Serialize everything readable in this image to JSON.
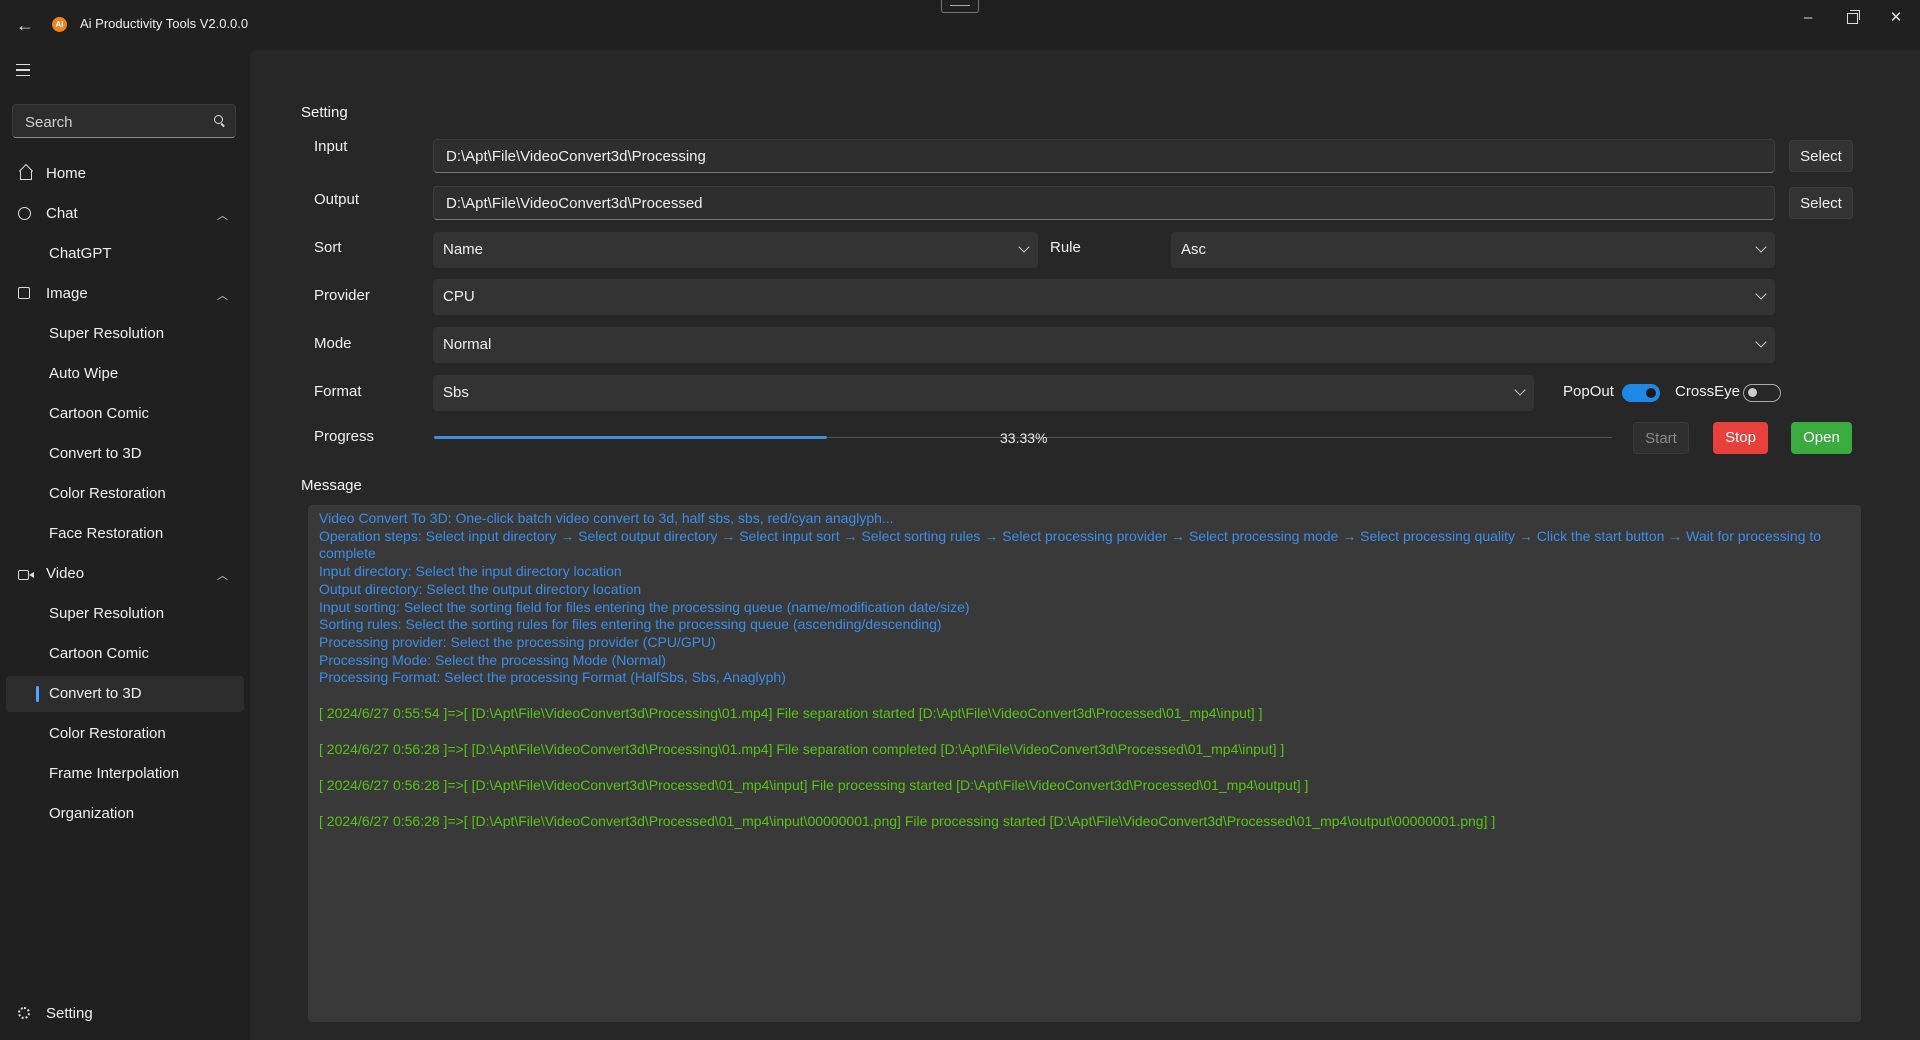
{
  "app": {
    "title": "Ai Productivity Tools V2.0.0.0",
    "logo_text": "AI",
    "back_icon": "arrow-left-icon",
    "colors": {
      "accent": "#4aa8ff",
      "stop": "#e8413c",
      "open": "#3bab3f",
      "info_text": "#3b8de8",
      "log_text": "#57c414"
    }
  },
  "window": {
    "minimize": "–",
    "close": "✕"
  },
  "sidebar": {
    "search_placeholder": "Search",
    "items": [
      {
        "label": "Home"
      },
      {
        "label": "Chat"
      },
      {
        "label": "ChatGPT"
      },
      {
        "label": "Image"
      },
      {
        "label": "Super Resolution"
      },
      {
        "label": "Auto Wipe"
      },
      {
        "label": "Cartoon Comic"
      },
      {
        "label": "Convert to 3D"
      },
      {
        "label": "Color Restoration"
      },
      {
        "label": "Face Restoration"
      },
      {
        "label": "Video"
      },
      {
        "label": "Super Resolution"
      },
      {
        "label": "Cartoon Comic"
      },
      {
        "label": "Convert to 3D"
      },
      {
        "label": "Color Restoration"
      },
      {
        "label": "Frame Interpolation"
      },
      {
        "label": "Organization"
      }
    ],
    "footer": {
      "label": "Setting"
    }
  },
  "setting": {
    "title": "Setting",
    "input": {
      "label": "Input",
      "value": "D:\\Apt\\File\\VideoConvert3d\\Processing",
      "button": "Select"
    },
    "output": {
      "label": "Output",
      "value": "D:\\Apt\\File\\VideoConvert3d\\Processed",
      "button": "Select"
    },
    "sort": {
      "label": "Sort",
      "value": "Name"
    },
    "rule": {
      "label": "Rule",
      "value": "Asc"
    },
    "provider": {
      "label": "Provider",
      "value": "CPU"
    },
    "mode": {
      "label": "Mode",
      "value": "Normal"
    },
    "format": {
      "label": "Format",
      "value": "Sbs"
    },
    "popout": {
      "label": "PopOut",
      "on": true
    },
    "crosseye": {
      "label": "CrossEye",
      "on": false
    },
    "progress": {
      "label": "Progress",
      "text": "33.33%",
      "fraction": 0.3333
    },
    "buttons": {
      "start": "Start",
      "stop": "Stop",
      "open": "Open"
    }
  },
  "message": {
    "title": "Message",
    "intro": [
      "Video Convert To 3D: One-click batch video convert to 3d, half sbs, sbs, red/cyan anaglyph...",
      "Operation steps: Select input directory → Select output directory → Select input sort → Select sorting rules → Select processing provider → Select processing mode → Select processing quality → Click the start button → Wait for processing to complete",
      "Input directory: Select the input directory location",
      "Output directory: Select the output directory location",
      "Input sorting: Select the sorting field for files entering the processing queue (name/modification date/size)",
      "Sorting rules: Select the sorting rules for files entering the processing queue (ascending/descending)",
      "Processing provider: Select the processing provider (CPU/GPU)",
      "Processing Mode: Select the processing Mode (Normal)",
      "Processing Format: Select the processing Format (HalfSbs, Sbs, Anaglyph)"
    ],
    "logs": [
      "[ 2024/6/27 0:55:54 ]=>[ [D:\\Apt\\File\\VideoConvert3d\\Processing\\01.mp4] File separation started [D:\\Apt\\File\\VideoConvert3d\\Processed\\01_mp4\\input] ]",
      "[ 2024/6/27 0:56:28 ]=>[ [D:\\Apt\\File\\VideoConvert3d\\Processing\\01.mp4] File separation completed [D:\\Apt\\File\\VideoConvert3d\\Processed\\01_mp4\\input] ]",
      "[ 2024/6/27 0:56:28 ]=>[ [D:\\Apt\\File\\VideoConvert3d\\Processed\\01_mp4\\input] File processing started [D:\\Apt\\File\\VideoConvert3d\\Processed\\01_mp4\\output] ]",
      "[ 2024/6/27 0:56:28 ]=>[ [D:\\Apt\\File\\VideoConvert3d\\Processed\\01_mp4\\input\\00000001.png] File processing started [D:\\Apt\\File\\VideoConvert3d\\Processed\\01_mp4\\output\\00000001.png] ]"
    ]
  }
}
